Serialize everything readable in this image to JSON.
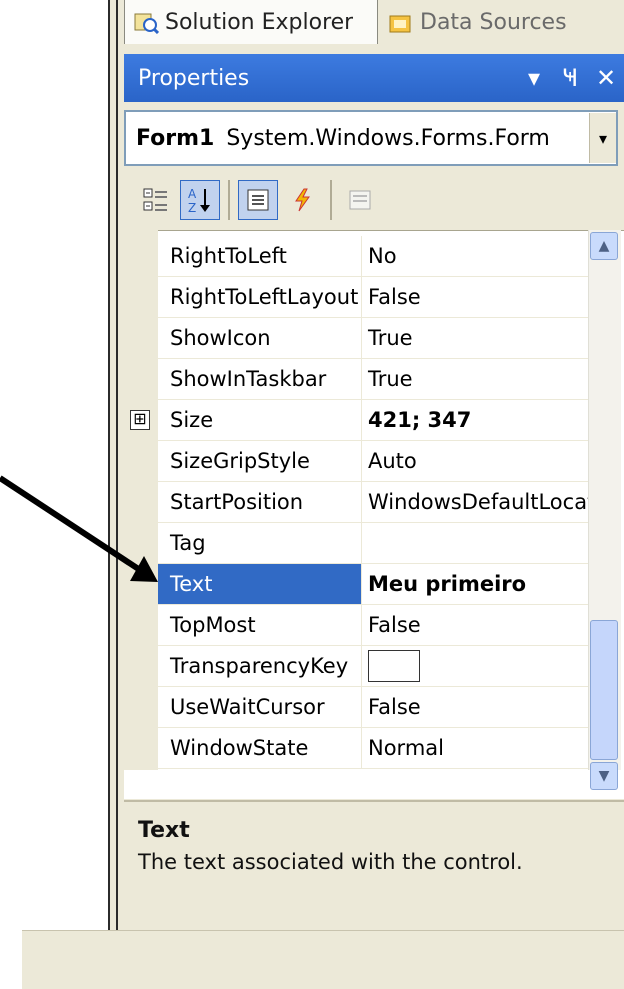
{
  "tabs": [
    {
      "label": "Solution Explorer",
      "icon": "solution-explorer-icon"
    },
    {
      "label": "Data Sources",
      "icon": "data-sources-icon"
    }
  ],
  "panel": {
    "title": "Properties",
    "buttons": {
      "dropdown": "▾",
      "pin": "Ҹ",
      "close": "✕"
    }
  },
  "object_selector": {
    "name": "Form1",
    "type": "System.Windows.Forms.Form",
    "dropdown": "▾"
  },
  "toolbar": {
    "buttons": [
      "categorized-icon",
      "alphabetical-icon",
      "properties-icon",
      "events-icon",
      "property-pages-icon"
    ]
  },
  "properties": [
    {
      "name": "RightToLeft",
      "value": "No"
    },
    {
      "name": "RightToLeftLayout",
      "value": "False"
    },
    {
      "name": "ShowIcon",
      "value": "True"
    },
    {
      "name": "ShowInTaskbar",
      "value": "True"
    },
    {
      "name": "Size",
      "value": "421; 347",
      "expander": "⊞"
    },
    {
      "name": "SizeGripStyle",
      "value": "Auto"
    },
    {
      "name": "StartPosition",
      "value": "WindowsDefaultLocation"
    },
    {
      "name": "Tag",
      "value": ""
    },
    {
      "name": "Text",
      "value": "Meu primeiro"
    },
    {
      "name": "TopMost",
      "value": "False"
    },
    {
      "name": "TransparencyKey",
      "value": ""
    },
    {
      "name": "UseWaitCursor",
      "value": "False"
    },
    {
      "name": "WindowState",
      "value": "Normal"
    }
  ],
  "description": {
    "title": "Text",
    "text": "The text associated with the control."
  },
  "colors": {
    "title_bar": "#2a64c8",
    "selection": "#316ac5"
  }
}
